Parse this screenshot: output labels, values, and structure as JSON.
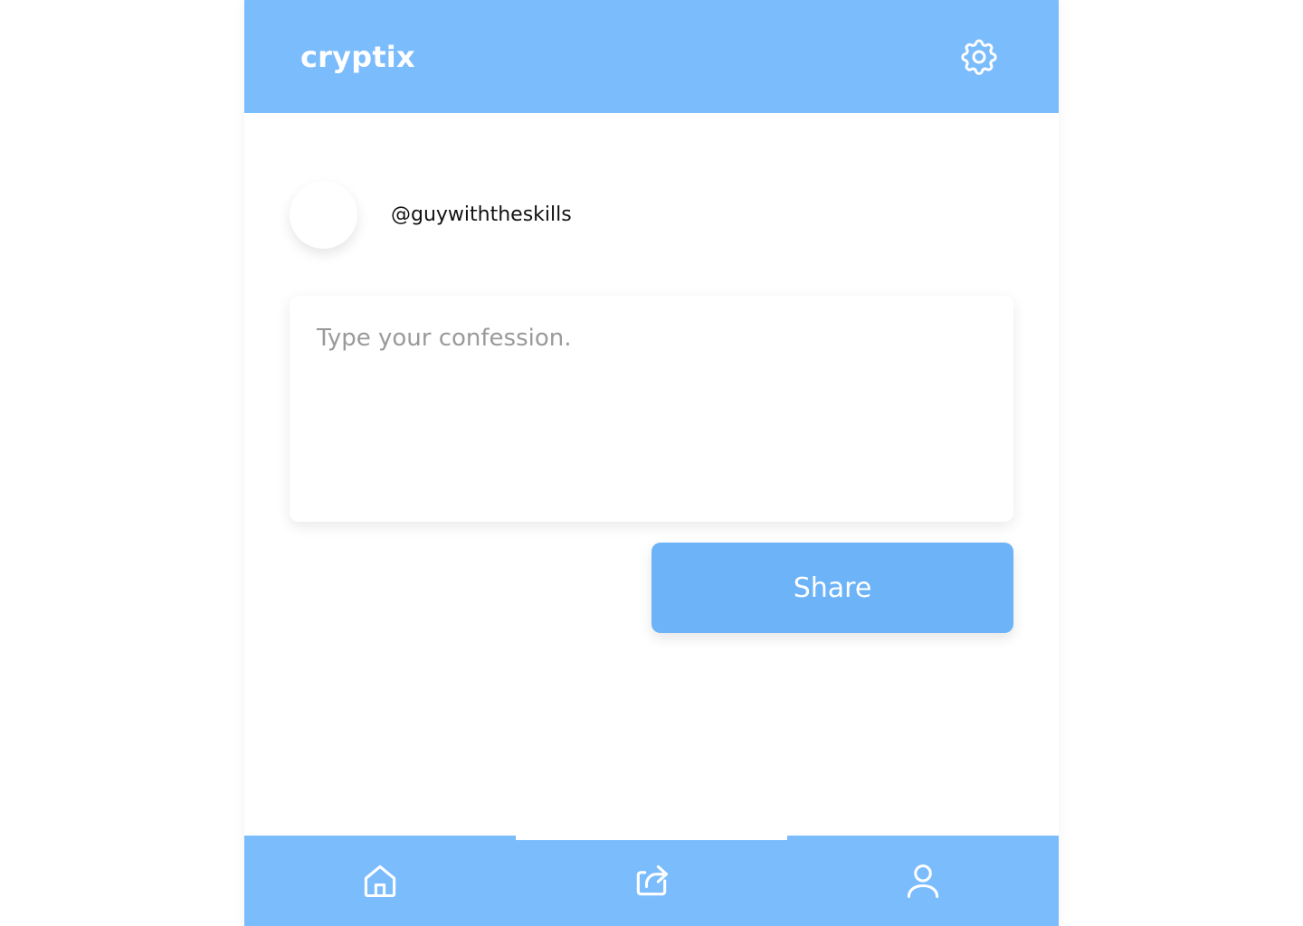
{
  "header": {
    "logo": "cryptix",
    "settings_icon": "gear-icon"
  },
  "profile": {
    "username": "@guywiththeskills"
  },
  "composer": {
    "placeholder": "Type your confession.",
    "value": ""
  },
  "actions": {
    "share_label": "Share"
  },
  "nav": {
    "items": [
      {
        "name": "home",
        "icon": "home-icon"
      },
      {
        "name": "share",
        "icon": "share-icon",
        "active": true
      },
      {
        "name": "profile",
        "icon": "user-icon"
      }
    ]
  },
  "colors": {
    "accent": "#7bbcfd",
    "button": "#6cb3f8"
  }
}
